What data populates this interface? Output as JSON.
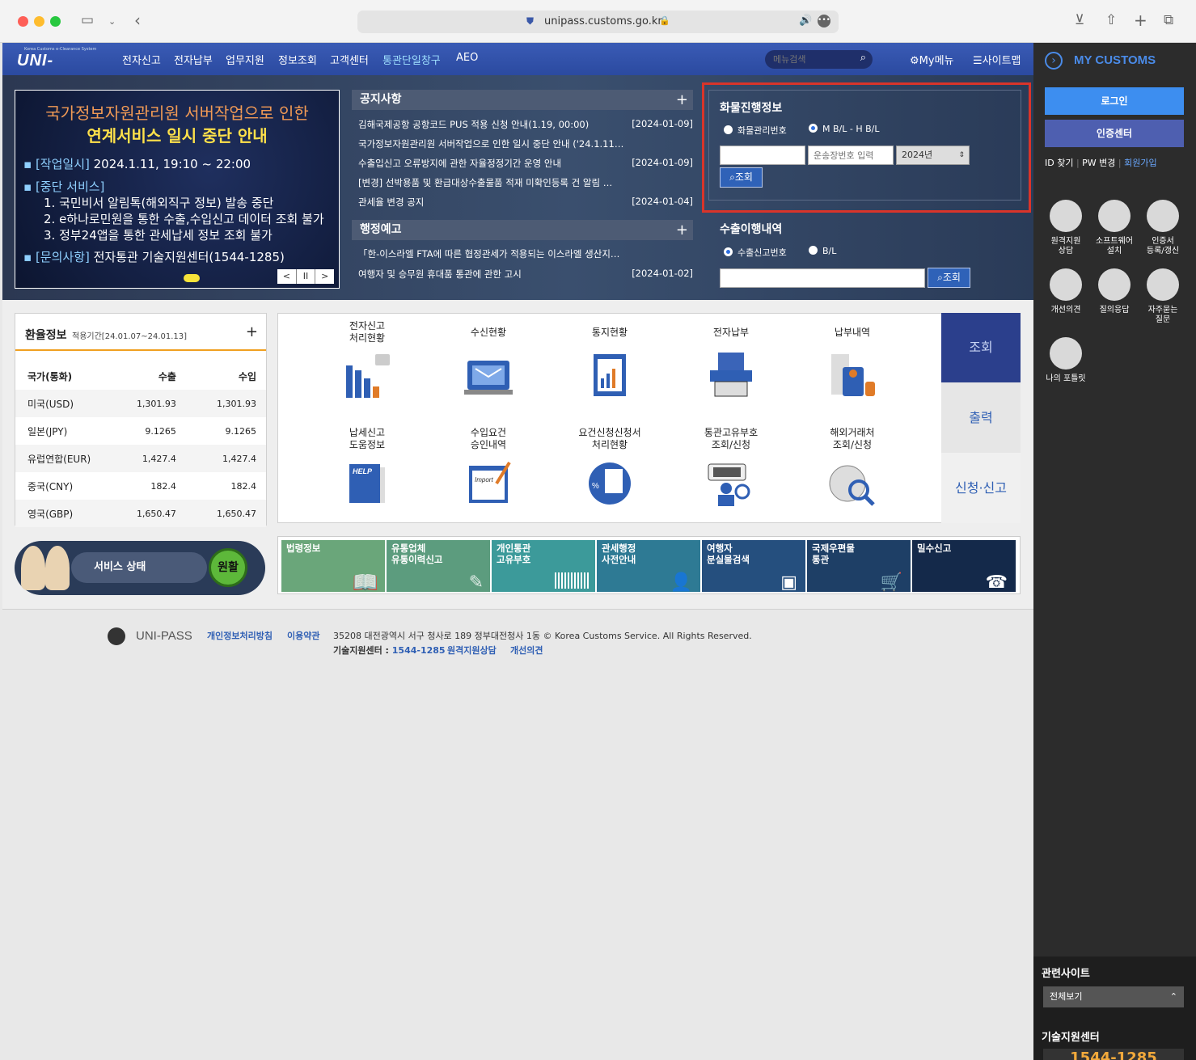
{
  "browser": {
    "url": "unipass.customs.go.kr"
  },
  "gnb": {
    "logo": "UNI-PASS",
    "logo_sub": "Korea Customs e-Clearance System",
    "menus": [
      "전자신고",
      "전자납부",
      "업무지원",
      "정보조회",
      "고객센터",
      "통관단일창구",
      "AEO"
    ],
    "search_placeholder": "메뉴검색",
    "mymenu": "My메뉴",
    "sitemap": "사이트맵"
  },
  "banner": {
    "line1": "국가정보자원관리원 서버작업으로 인한",
    "line2": "연계서비스 일시 중단 안내",
    "items": [
      {
        "k": "[작업일시]",
        "v": " 2024.1.11, 19:10 ~ 22:00"
      },
      {
        "k": "[중단 서비스]",
        "v": ""
      },
      {
        "k": "",
        "v": "1. 국민비서 알림톡(해외직구 정보) 발송 중단"
      },
      {
        "k": "",
        "v": "2. e하나로민원을 통한 수출,수입신고 데이터 조회 불가"
      },
      {
        "k": "",
        "v": "3. 정부24앱을 통한 관세납세 정보 조회 불가"
      },
      {
        "k": "[문의사항]",
        "v": " 전자통관 기술지원센터(1544-1285)"
      }
    ],
    "ctrl": [
      "<",
      "II",
      ">"
    ]
  },
  "notice": {
    "title": "공지사항",
    "plus": "+",
    "rows": [
      {
        "t": "김해국제공항 공항코드 PUS 적용 신청 안내(1.19, 00:00)",
        "d": "[2024-01-09]"
      },
      {
        "t": "국가정보자원관리원 서버작업으로 인한 일시 중단 안내 ('24.1.11,…",
        "d": ""
      },
      {
        "t": "수출입신고 오류방지에 관한 자율정정기간 운영 안내",
        "d": "[2024-01-09]"
      },
      {
        "t": "[변경] 선박용품 및 환급대상수출물품 적재 미확인등록 건 알림 …",
        "d": ""
      },
      {
        "t": "관세율 변경 공지",
        "d": "[2024-01-04]"
      }
    ]
  },
  "admin": {
    "title": "행정예고",
    "plus": "+",
    "rows": [
      {
        "t": "「한-이스라엘 FTA에 따른 협정관세가 적용되는 이스라엘 생산지…",
        "d": ""
      },
      {
        "t": "여행자 및 승무원 휴대품 통관에 관한 고시",
        "d": "[2024-01-02]"
      }
    ]
  },
  "cargo": {
    "title": "화물진행정보",
    "radio1": "화물관리번호",
    "radio2": "M B/L - H B/L",
    "placeholder": "운송장번호 입력",
    "year": "2024년",
    "btn": "조회"
  },
  "export": {
    "title": "수출이행내역",
    "radio1": "수출신고번호",
    "radio2": "B/L",
    "btn": "조회"
  },
  "exchange": {
    "title": "환율정보",
    "period": "적용기간[24.01.07~24.01.13]",
    "plus": "+",
    "headers": [
      "국가(통화)",
      "수출",
      "수입"
    ],
    "rows": [
      [
        "미국(USD)",
        "1,301.93",
        "1,301.93"
      ],
      [
        "일본(JPY)",
        "9.1265",
        "9.1265"
      ],
      [
        "유럽연합(EUR)",
        "1,427.4",
        "1,427.4"
      ],
      [
        "중국(CNY)",
        "182.4",
        "182.4"
      ],
      [
        "영국(GBP)",
        "1,650.47",
        "1,650.47"
      ]
    ]
  },
  "service": {
    "label": "서비스 상태",
    "status": "원활"
  },
  "grid": [
    [
      "전자신고",
      "처리현황"
    ],
    [
      "수신현황",
      ""
    ],
    [
      "통지현황",
      ""
    ],
    [
      "전자납부",
      ""
    ],
    [
      "납부내역",
      ""
    ],
    [
      "납세신고",
      "도움정보"
    ],
    [
      "수입요건",
      "승인내역"
    ],
    [
      "요건신청신청서",
      "처리현황"
    ],
    [
      "통관고유부호",
      "조회/신청"
    ],
    [
      "해외거래처",
      "조회/신청"
    ]
  ],
  "tabs": [
    "조회",
    "출력",
    "신청·신고"
  ],
  "tiles": [
    [
      "법령정보",
      ""
    ],
    [
      "유통업체",
      "유통이력신고"
    ],
    [
      "개인통관",
      "고유부호"
    ],
    [
      "관세행정",
      "사전안내"
    ],
    [
      "여행자",
      "분실물검색"
    ],
    [
      "국제우편물",
      "통관"
    ],
    [
      "밀수신고",
      ""
    ]
  ],
  "footer": {
    "brand": "UNI-PASS",
    "links": [
      "개인정보처리방침",
      "이용약관"
    ],
    "addr": "35208 대전광역시 서구 청사로 189 정부대전청사 1동 © Korea Customs Service. All Rights Reserved.",
    "tech_label": "기술지원센터 : ",
    "tech_num": "1544-1285",
    "links2": [
      "원격지원상담",
      "개선의견"
    ]
  },
  "right": {
    "title": "MY CUSTOMS",
    "login": "로그인",
    "cert": "인증센터",
    "links": [
      "ID 찾기",
      "PW 변경",
      "회원가입"
    ],
    "icons": [
      [
        "원격지원",
        "상담"
      ],
      [
        "소프트웨어",
        "설치"
      ],
      [
        "인증서",
        "등록/갱신"
      ],
      [
        "개선의견",
        ""
      ],
      [
        "질의응답",
        ""
      ],
      [
        "자주묻는",
        "질문"
      ],
      [
        "나의 포틀릿",
        ""
      ]
    ],
    "related": "관련사이트",
    "related_sel": "전체보기",
    "tech": "기술지원센터",
    "tech_num": "1544-1285"
  }
}
